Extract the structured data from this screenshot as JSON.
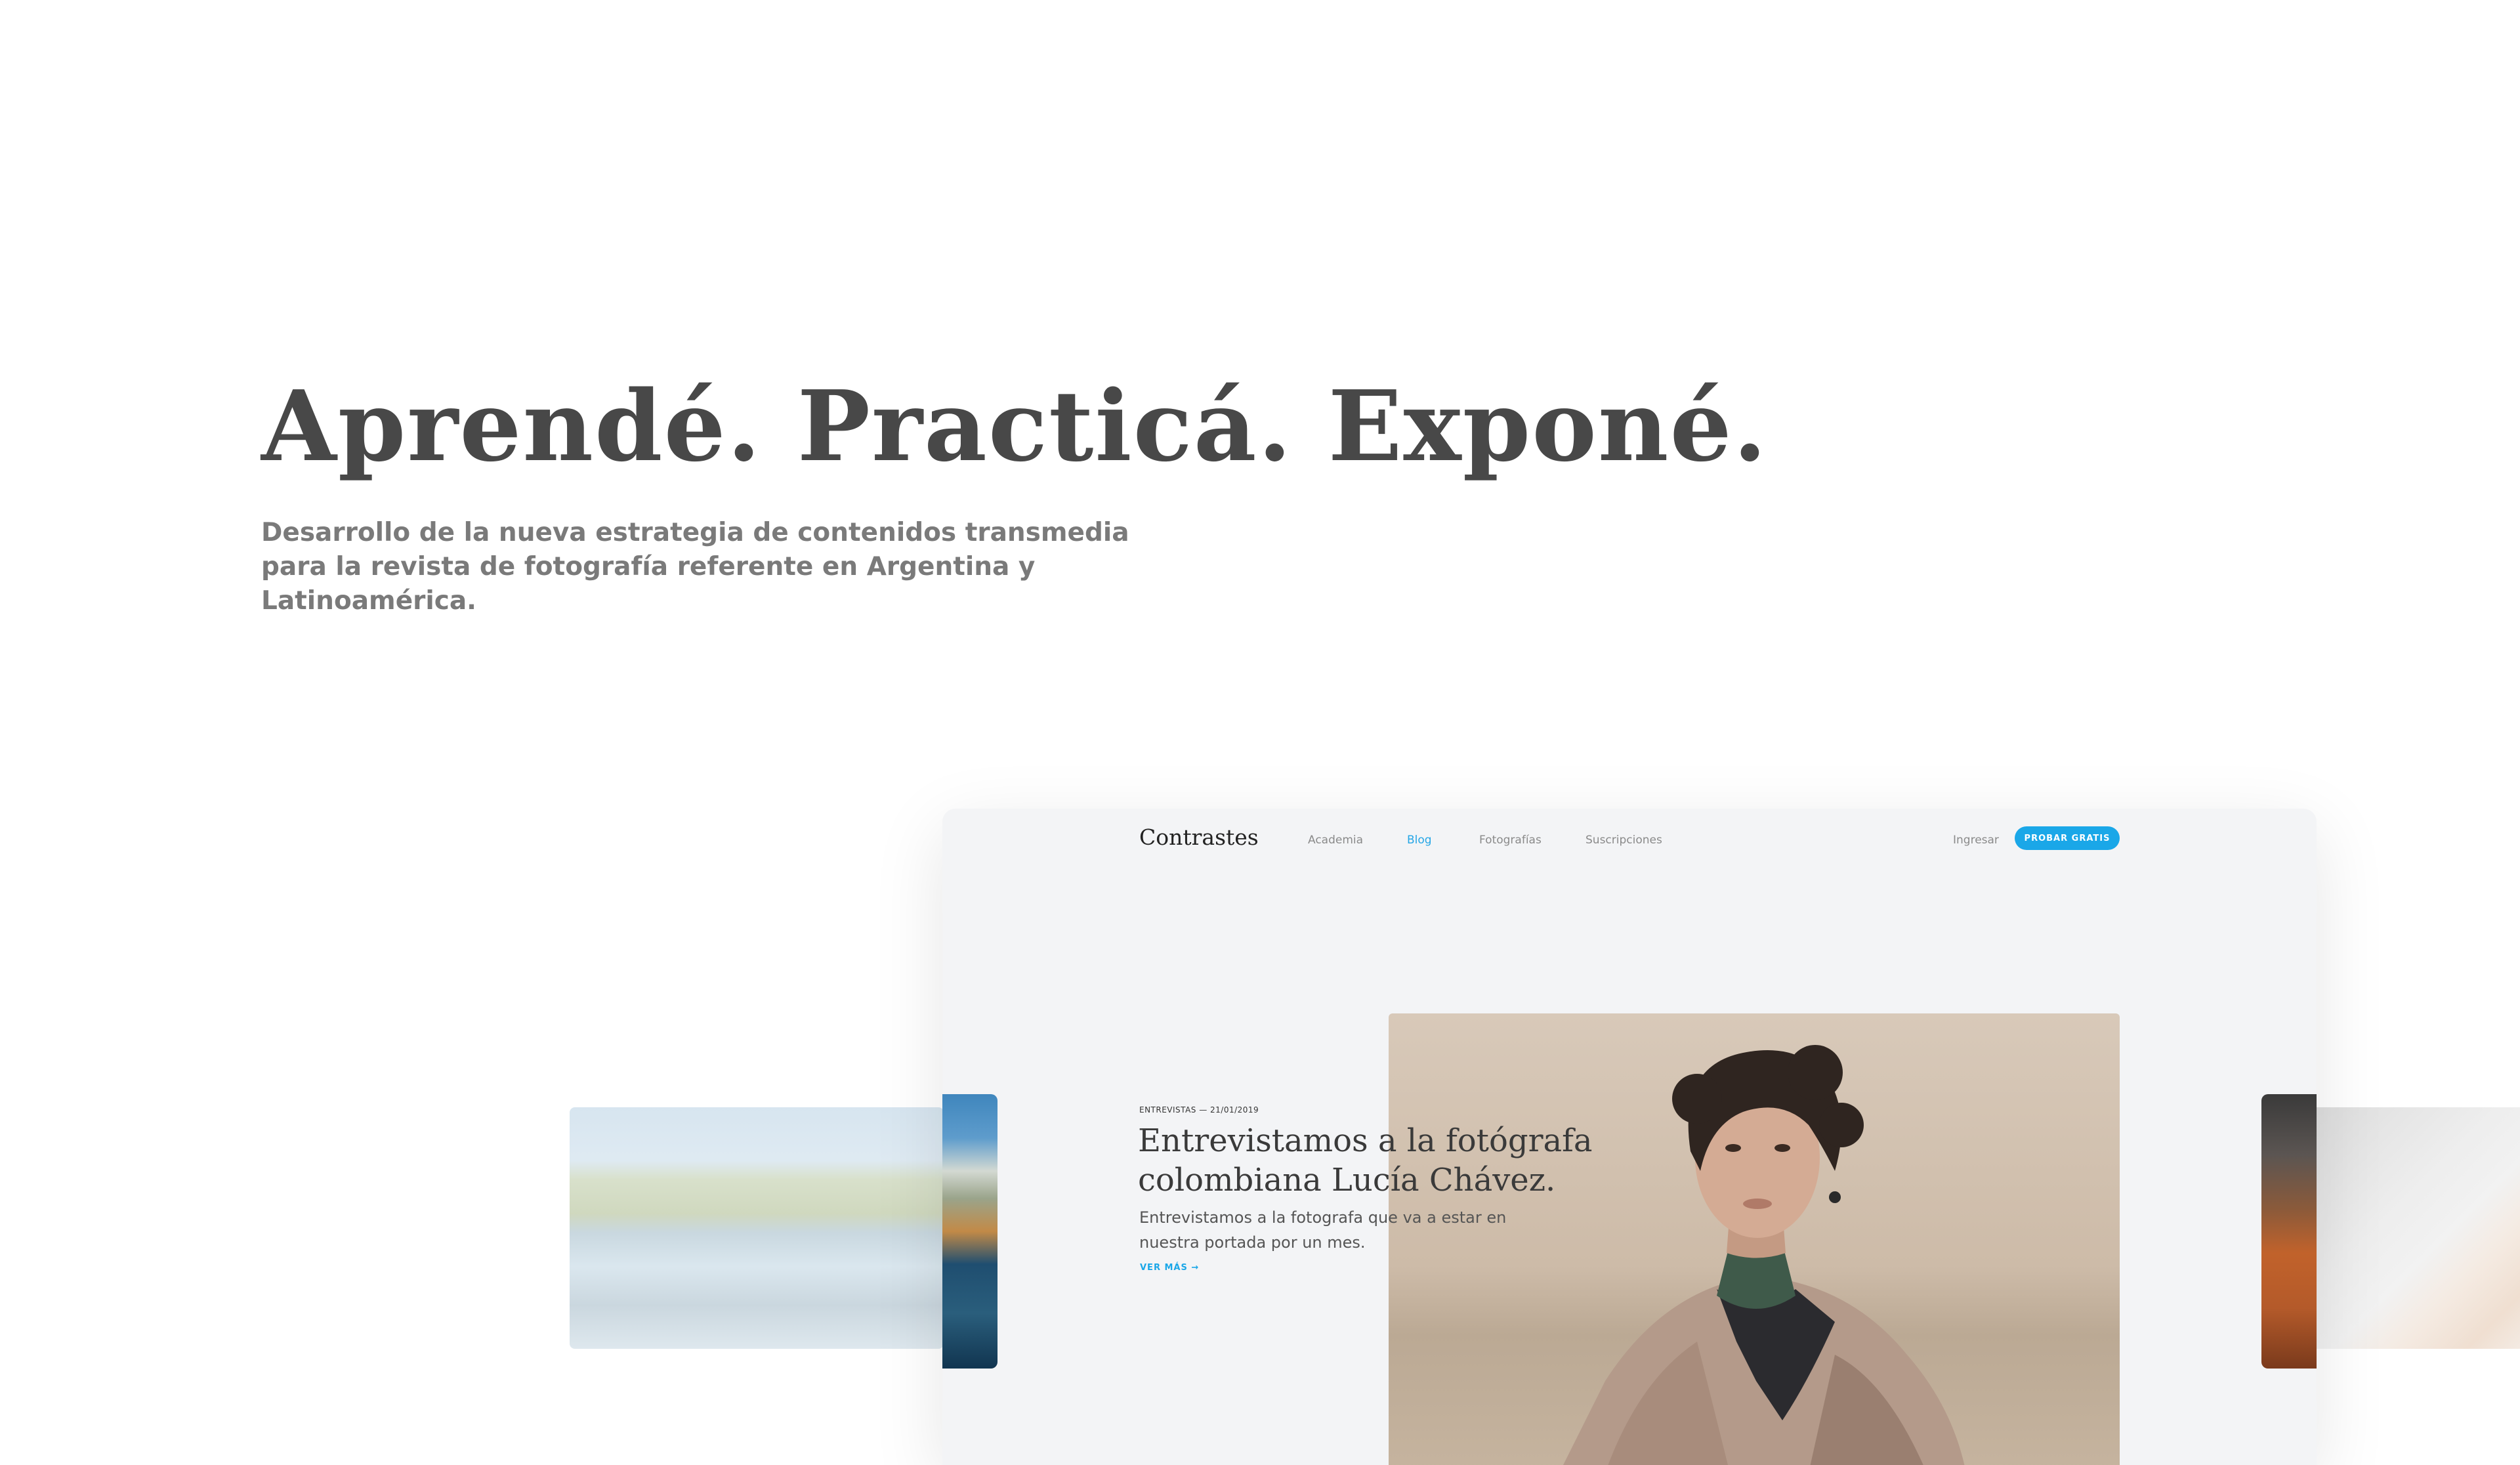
{
  "hero": {
    "title": "Aprendé. Practicá. Exponé.",
    "subtitle": "Desarrollo de la nueva estrategia de contenidos transmedia para la revista de fotografía referente en Argentina y Latinoamérica."
  },
  "site": {
    "brand": "Contrastes",
    "nav": [
      "Academia",
      "Blog",
      "Fotografías",
      "Suscripciones"
    ],
    "active_nav": "Blog",
    "login_label": "Ingresar",
    "cta_label": "PROBAR GRATIS"
  },
  "post": {
    "meta": "ENTREVISTAS — 21/01/2019",
    "title": "Entrevistamos a la fotógrafa colombiana Lucía Chávez.",
    "excerpt": "Entrevistamos a la fotografa que va a estar en nuestra portada por un mes.",
    "read_more": "VER MÁS →"
  },
  "colors": {
    "accent": "#1aa7e8",
    "hero_text": "#484848",
    "subtitle_text": "#7a7a7a",
    "mockup_bg": "#f3f4f6"
  }
}
